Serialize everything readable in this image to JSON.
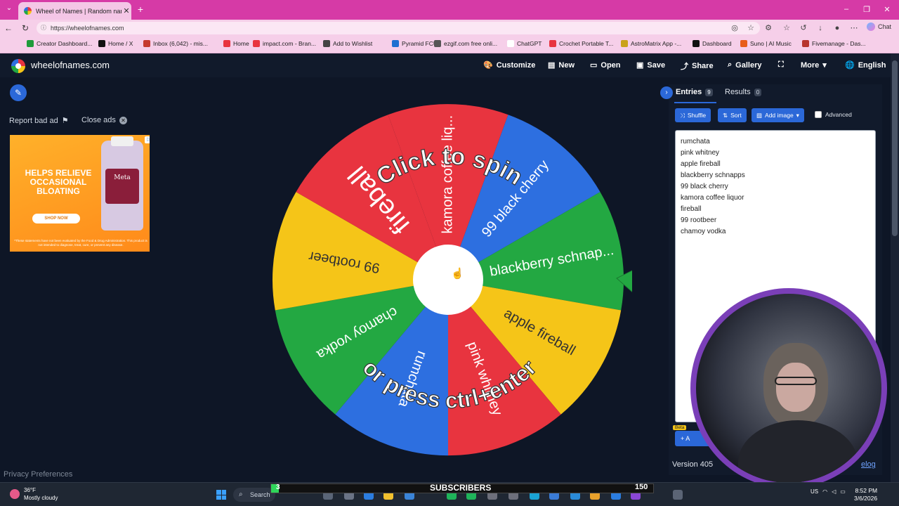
{
  "browser": {
    "tab_title": "Wheel of Names | Random name ...",
    "url": "https://wheelofnames.com",
    "chat_label": "Chat",
    "bookmarks": [
      {
        "label": "Creator Dashboard...",
        "color": "#1e9b3a"
      },
      {
        "label": "Home / X",
        "color": "#111111"
      },
      {
        "label": "Inbox (6,042) - mis...",
        "color": "#c53a2f"
      },
      {
        "label": "Home",
        "color": "#e8343f"
      },
      {
        "label": "impact.com - Bran...",
        "color": "#e8343f"
      },
      {
        "label": "Add to Wishlist",
        "color": "#444444"
      },
      {
        "label": "Pyramid FCU",
        "color": "#1f6fd1"
      },
      {
        "label": "ezgif.com free onli...",
        "color": "#555555"
      },
      {
        "label": "ChatGPT",
        "color": "#ffffff"
      },
      {
        "label": "Crochet Portable T...",
        "color": "#e8343f"
      },
      {
        "label": "AstroMatrix App -...",
        "color": "#caa21a"
      },
      {
        "label": "Dashboard",
        "color": "#111111"
      },
      {
        "label": "Suno | AI Music",
        "color": "#e85d1a"
      },
      {
        "label": "Fivemanage - Das...",
        "color": "#b7352f"
      }
    ]
  },
  "header": {
    "site_name": "wheelofnames.com",
    "customize": "Customize",
    "new": "New",
    "open": "Open",
    "save": "Save",
    "share": "Share",
    "gallery": "Gallery",
    "more": "More",
    "language": "English"
  },
  "left": {
    "report_ad": "Report bad ad",
    "close_ads": "Close ads",
    "ad_text": "HELPS RELIEVE OCCASIONAL BLOATING",
    "ad_shop": "SHOP NOW",
    "ad_brand": "Meta",
    "ad_fine": "*These statements have not been evaluated by the Food & Drug Administration. This product is not intended to diagnose, treat, cure, or prevent any disease.",
    "privacy": "Privacy Preferences"
  },
  "wheel": {
    "click_to_spin": "Click to spin",
    "press_hint": "or press ctrl+enter",
    "colors": [
      "#e8343f",
      "#2d6fe0",
      "#23a842",
      "#f5c518"
    ],
    "segments": [
      "kamora coffee liq...",
      "99 black cherry",
      "blackberry schnap...",
      "apple fireball",
      "pink whitney",
      "rumchata",
      "chamoy vodka",
      "99 rootbeer",
      "fireball"
    ],
    "pointer_color": "#23a842"
  },
  "panel": {
    "entries_tab": "Entries",
    "entries_count": "9",
    "results_tab": "Results",
    "results_count": "0",
    "shuffle": "Shuffle",
    "sort": "Sort",
    "add_image": "Add image",
    "advanced": "Advanced",
    "entries": [
      "rumchata",
      "pink whitney",
      "apple fireball",
      "blackberry schnapps",
      "99 black cherry",
      "kamora coffee liquor",
      "fireball",
      "99 rootbeer",
      "chamoy vodka"
    ],
    "beta": "Beta",
    "add_label": "A",
    "version": "Version 405",
    "changelog": "elog"
  },
  "taskbar": {
    "temp": "36°F",
    "weather": "Mostly cloudy",
    "search": "Search",
    "subscribers_label": "SUBSCRIBERS",
    "subscribers_current": "3",
    "subscribers_goal": "150",
    "subscribers_progress": 0.02,
    "lang": "US",
    "time": "8:52 PM",
    "date": "3/6/2026"
  }
}
